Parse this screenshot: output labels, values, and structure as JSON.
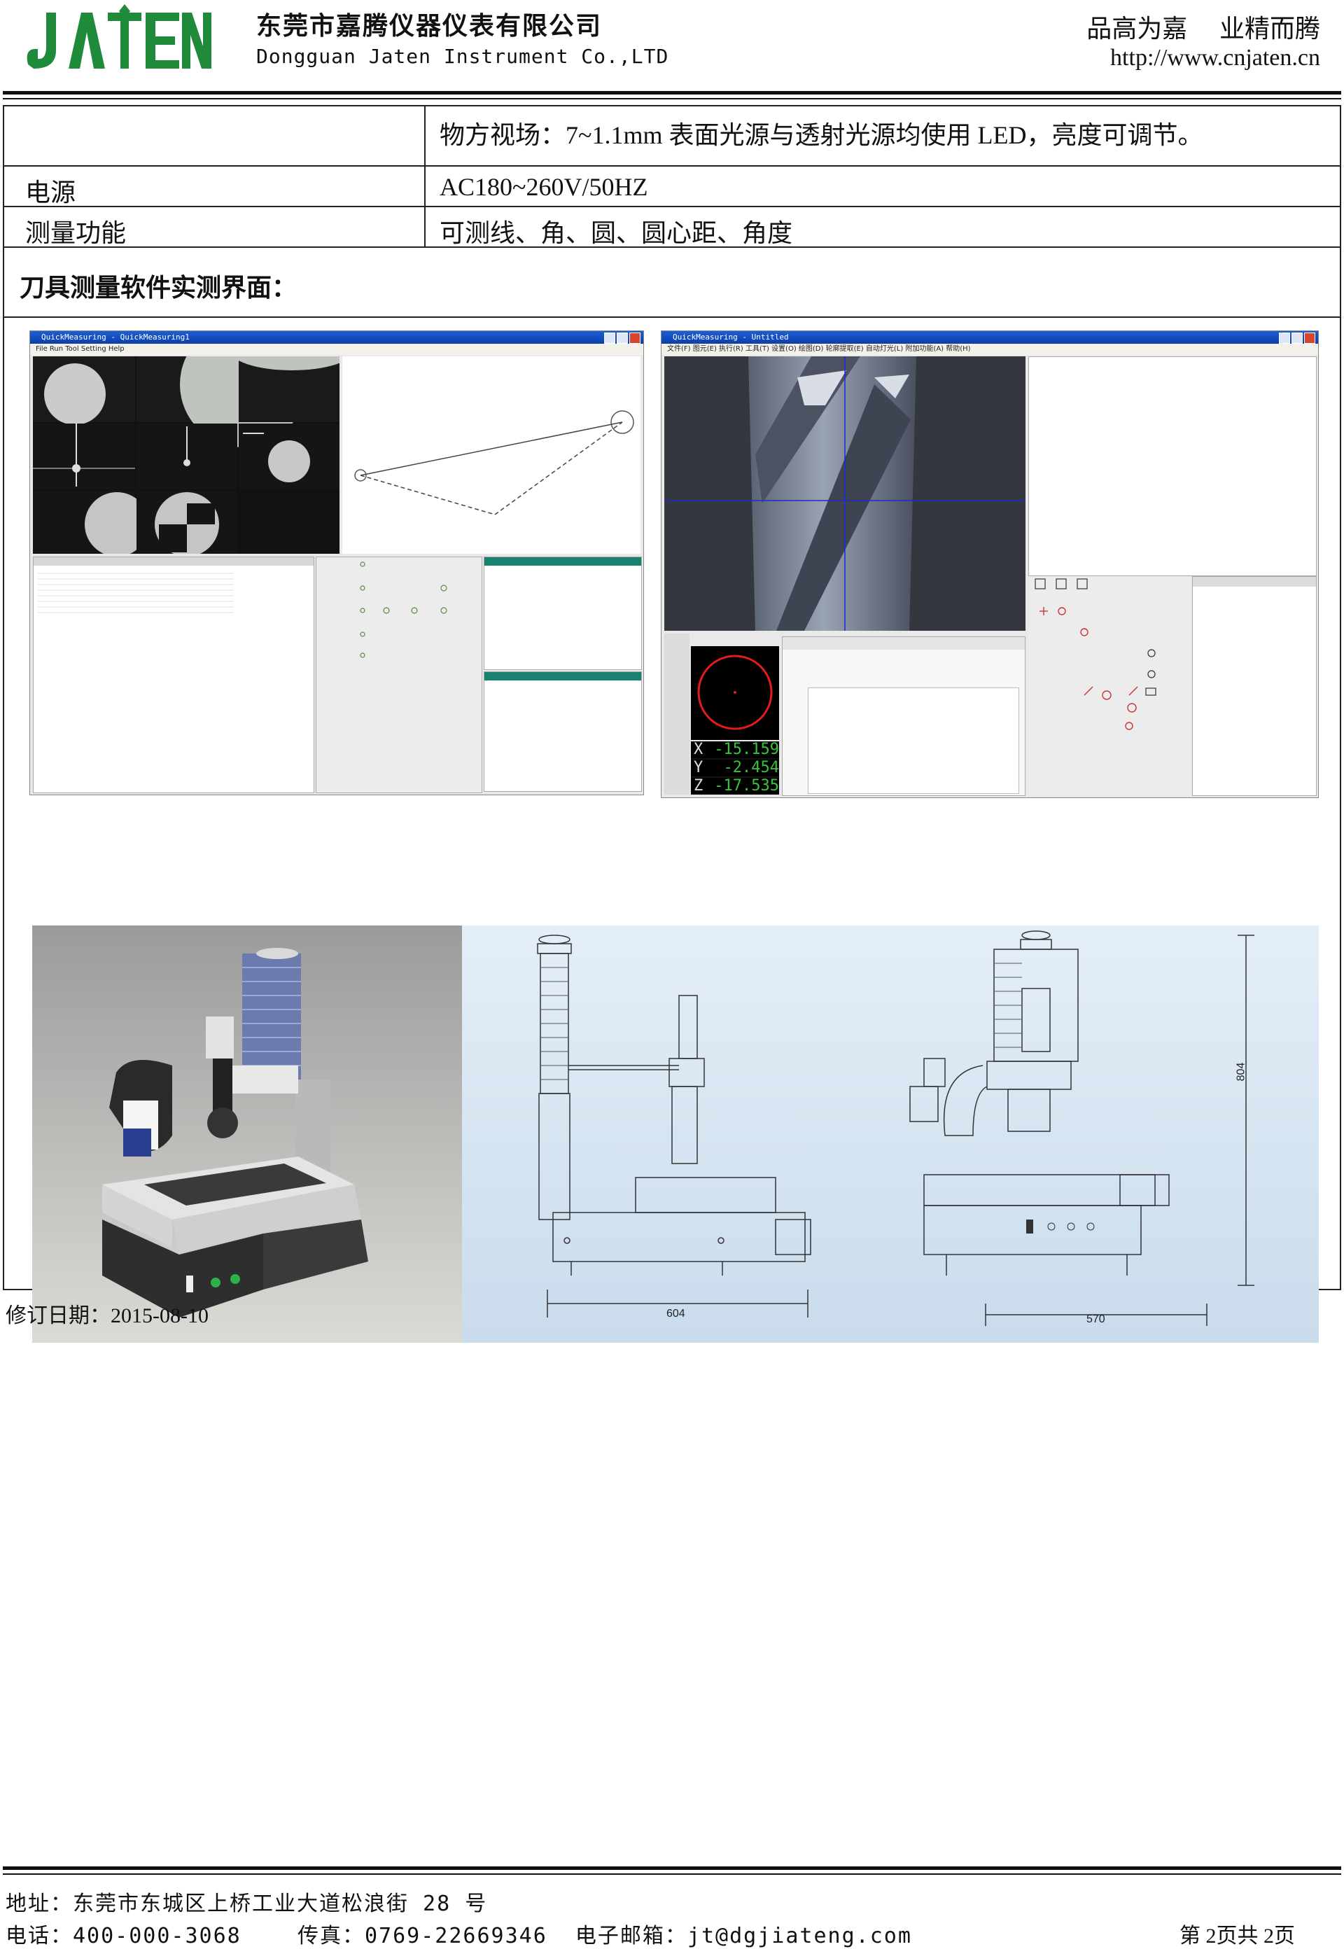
{
  "header": {
    "logo_text": "JATEN",
    "company_cn": "东莞市嘉腾仪器仪表有限公司",
    "company_en": "Dongguan Jaten Instrument Co.,LTD",
    "slogan": "品高为嘉    业精而腾",
    "url": "http://www.cnjaten.cn"
  },
  "spec_rows": [
    {
      "label": "",
      "value": "物方视场：7~1.1mm  表面光源与透射光源均使用 LED，亮度可调节。"
    },
    {
      "label": "电源",
      "value": "AC180~260V/50HZ"
    },
    {
      "label": "测量功能",
      "value": "可测线、角、圆、圆心距、角度"
    }
  ],
  "section_title": "刀具测量软件实测界面：",
  "screenshot_left": {
    "title": "QuickMeasuring - QuickMeasuring1",
    "menu": "File  Run  Tool  Setting  Help"
  },
  "screenshot_right": {
    "title": "QuickMeasuring - Untitled",
    "menu": "文件(F)  图元(E)  执行(R)  工具(T)  设置(O)  绘图(D)  轮廓提取(E)  自动灯光(L)  附加功能(A)  帮助(H)",
    "readouts": [
      {
        "axis": "X",
        "value": "-15.159"
      },
      {
        "axis": "Y",
        "value": "-2.454"
      },
      {
        "axis": "Z",
        "value": "-17.535"
      }
    ]
  },
  "drawings": {
    "side_width": "604",
    "front_width": "570",
    "front_height": "804"
  },
  "revision_date": "修订日期：2015-08-10",
  "footer": {
    "address": "地址：东莞市东城区上桥工业大道松浪街 28 号",
    "contact": "电话：400-000-3068    传真：0769-22669346  电子邮箱：jt@dgjiateng.com",
    "page": "第 2页共 2页"
  },
  "colors": {
    "logo_green": "#1e8a3a",
    "titlebar_blue": "#1d5fd4",
    "readout_green": "#39c43b"
  }
}
